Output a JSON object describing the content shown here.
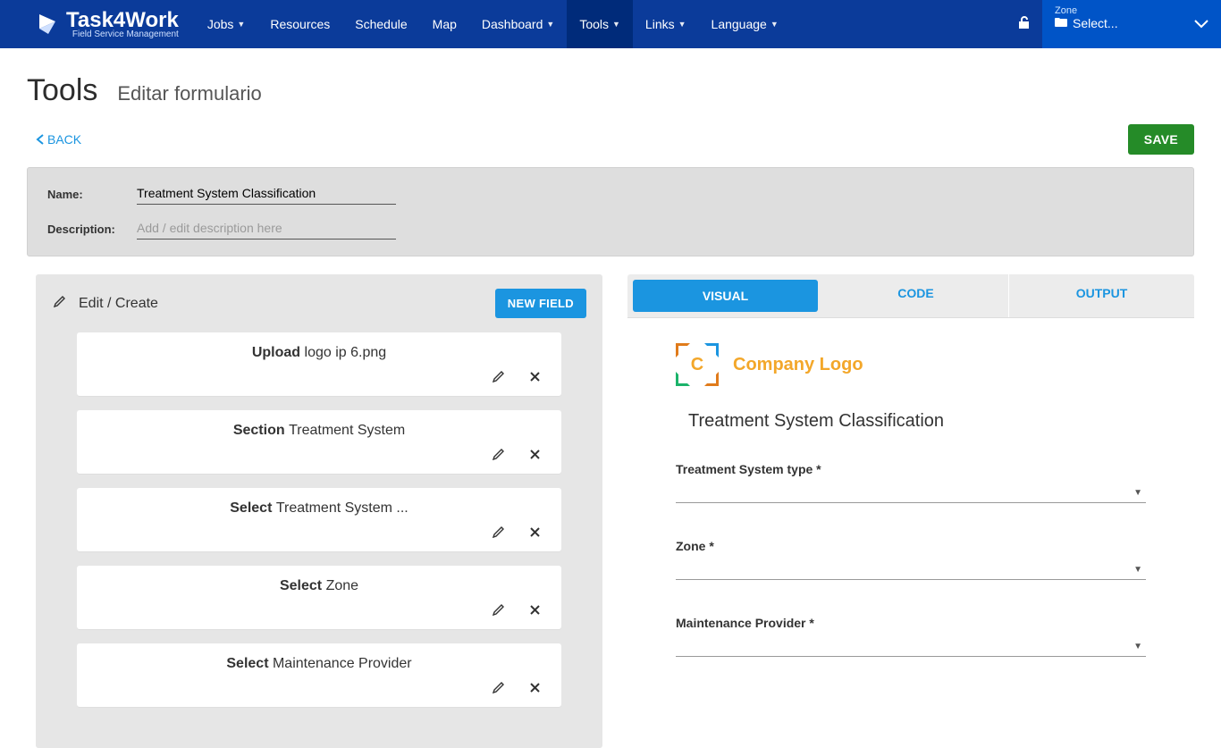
{
  "brand": {
    "name": "Task4Work",
    "tagline": "Field Service Management"
  },
  "nav": {
    "items": [
      {
        "label": "Jobs",
        "caret": true
      },
      {
        "label": "Resources",
        "caret": false
      },
      {
        "label": "Schedule",
        "caret": false
      },
      {
        "label": "Map",
        "caret": false
      },
      {
        "label": "Dashboard",
        "caret": true
      },
      {
        "label": "Tools",
        "caret": true,
        "active": true
      },
      {
        "label": "Links",
        "caret": true
      },
      {
        "label": "Language",
        "caret": true
      }
    ],
    "zone": {
      "label": "Zone",
      "value": "Select..."
    }
  },
  "page": {
    "title": "Tools",
    "subtitle": "Editar formulario"
  },
  "actions": {
    "back": "BACK",
    "save": "SAVE"
  },
  "meta": {
    "name_label": "Name:",
    "name_value": "Treatment System Classification",
    "desc_label": "Description:",
    "desc_placeholder": "Add / edit description here"
  },
  "left_panel": {
    "title": "Edit / Create",
    "new_field": "NEW FIELD",
    "cards": [
      {
        "type": "Upload",
        "value": "logo ip 6.png"
      },
      {
        "type": "Section",
        "value": "Treatment System"
      },
      {
        "type": "Select",
        "value": "Treatment System ..."
      },
      {
        "type": "Select",
        "value": "Zone"
      },
      {
        "type": "Select",
        "value": "Maintenance Provider"
      }
    ]
  },
  "right_panel": {
    "tabs": {
      "visual": "VISUAL",
      "code": "CODE",
      "output": "OUTPUT"
    },
    "logo_text": "Company Logo",
    "form_title": "Treatment System Classification",
    "fields": [
      {
        "label": "Treatment System type",
        "required": true
      },
      {
        "label": "Zone",
        "required": true
      },
      {
        "label": "Maintenance Provider",
        "required": true
      }
    ]
  }
}
